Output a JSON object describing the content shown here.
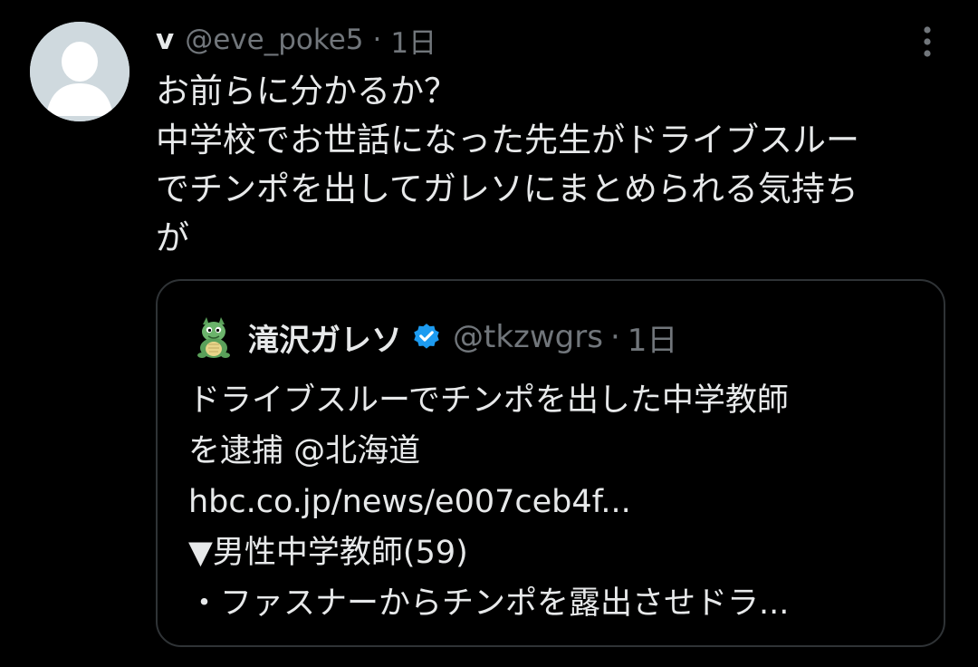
{
  "tweet": {
    "display_name": "v",
    "handle": "@eve_poke5",
    "separator": "·",
    "time": "1日",
    "text_lines": [
      "お前らに分かるか？",
      "中学校でお世話になった先生がドライブスルー",
      "でチンポを出してガレソにまとめられる気持ち",
      "が"
    ],
    "more_icon": "more-vertical-icon",
    "avatar_icon": "default-avatar-icon"
  },
  "quote": {
    "display_name": "滝沢ガレソ",
    "handle": "@tkzwgrs",
    "separator": "·",
    "time": "1日",
    "verified_icon": "verified-badge-icon",
    "avatar_icon": "dragon-avatar-icon",
    "text_lines": [
      "ドライブスルーでチンポを出した中学教師",
      "を逮捕 @北海道",
      "hbc.co.jp/news/e007ceb4f...",
      "▼男性中学教師(59)",
      "・ファスナーからチンポを露出させドラ..."
    ]
  },
  "colors": {
    "background": "#000000",
    "primary_text": "#e7e9ea",
    "secondary_text": "#71767b",
    "border": "#2f3336",
    "verified": "#1d9bf0"
  }
}
